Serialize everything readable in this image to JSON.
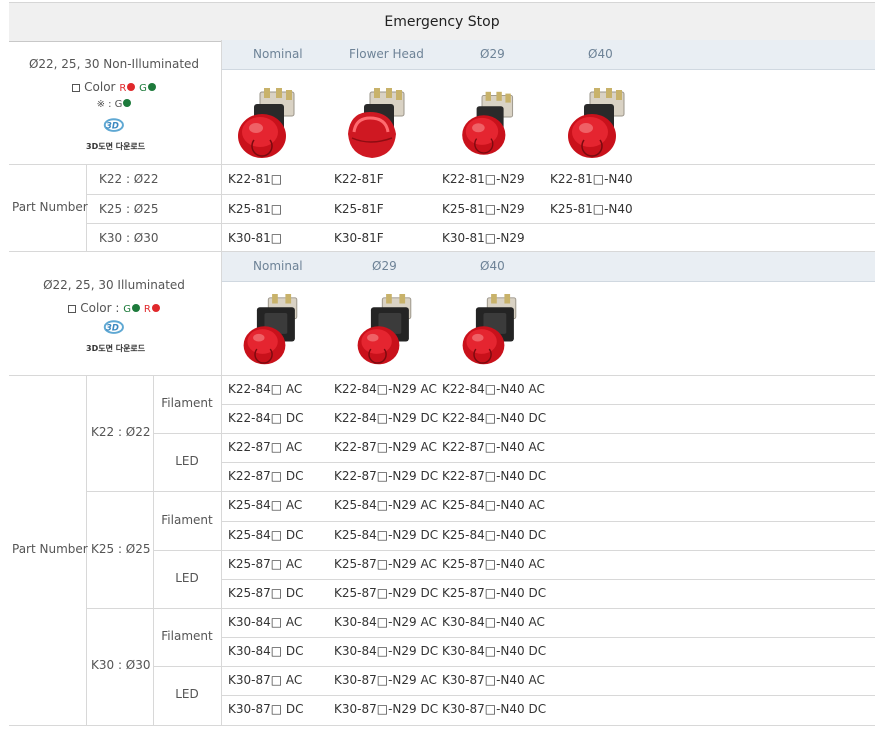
{
  "title": "Emergency Stop",
  "colors": {
    "red": "#e0282b",
    "green": "#1d7a3b",
    "header_bg": "#e9eef3",
    "header_text": "#6e8397"
  },
  "section1": {
    "name": "Ø22, 25, 30 Non-Illuminated",
    "color_label": "Color",
    "color_letters": [
      "R",
      "G"
    ],
    "note_symbol": "※ : G",
    "download_label": "3D도면 다운로드",
    "columns": [
      "Nominal",
      "Flower Head",
      "Ø29",
      "Ø40"
    ],
    "part_number_label": "Part Number",
    "rows": [
      {
        "size": "K22 : Ø22",
        "cells": [
          "K22-81□",
          "K22-81F",
          "K22-81□-N29",
          "K22-81□-N40"
        ]
      },
      {
        "size": "K25 : Ø25",
        "cells": [
          "K25-81□",
          "K25-81F",
          "K25-81□-N29",
          "K25-81□-N40"
        ]
      },
      {
        "size": "K30 : Ø30",
        "cells": [
          "K30-81□",
          "K30-81F",
          "K30-81□-N29",
          ""
        ]
      }
    ]
  },
  "section2": {
    "name": "Ø22, 25, 30 Illuminated",
    "color_label": "Color :",
    "color_letters": [
      "G",
      "R"
    ],
    "download_label": "3D도면 다운로드",
    "columns": [
      "Nominal",
      "Ø29",
      "Ø40"
    ],
    "part_number_label": "Part Number",
    "groups": [
      {
        "size": "K22 : Ø22",
        "types": [
          {
            "type": "Filament",
            "rows": [
              [
                "K22-84□ AC",
                "K22-84□-N29 AC",
                "K22-84□-N40 AC"
              ],
              [
                "K22-84□ DC",
                "K22-84□-N29 DC",
                "K22-84□-N40 DC"
              ]
            ]
          },
          {
            "type": "LED",
            "rows": [
              [
                "K22-87□ AC",
                "K22-87□-N29 AC",
                "K22-87□-N40 AC"
              ],
              [
                "K22-87□ DC",
                "K22-87□-N29 DC",
                "K22-87□-N40 DC"
              ]
            ]
          }
        ]
      },
      {
        "size": "K25 : Ø25",
        "types": [
          {
            "type": "Filament",
            "rows": [
              [
                "K25-84□ AC",
                "K25-84□-N29 AC",
                "K25-84□-N40 AC"
              ],
              [
                "K25-84□ DC",
                "K25-84□-N29 DC",
                "K25-84□-N40 DC"
              ]
            ]
          },
          {
            "type": "LED",
            "rows": [
              [
                "K25-87□ AC",
                "K25-87□-N29 AC",
                "K25-87□-N40 AC"
              ],
              [
                "K25-87□ DC",
                "K25-87□-N29 DC",
                "K25-87□-N40 DC"
              ]
            ]
          }
        ]
      },
      {
        "size": "K30 : Ø30",
        "types": [
          {
            "type": "Filament",
            "rows": [
              [
                "K30-84□ AC",
                "K30-84□-N29 AC",
                "K30-84□-N40 AC"
              ],
              [
                "K30-84□ DC",
                "K30-84□-N29 DC",
                "K30-84□-N40 DC"
              ]
            ]
          },
          {
            "type": "LED",
            "rows": [
              [
                "K30-87□ AC",
                "K30-87□-N29 AC",
                "K30-87□-N40 AC"
              ],
              [
                "K30-87□ DC",
                "K30-87□-N29 DC",
                "K30-87□-N40 DC"
              ]
            ]
          }
        ]
      }
    ]
  }
}
